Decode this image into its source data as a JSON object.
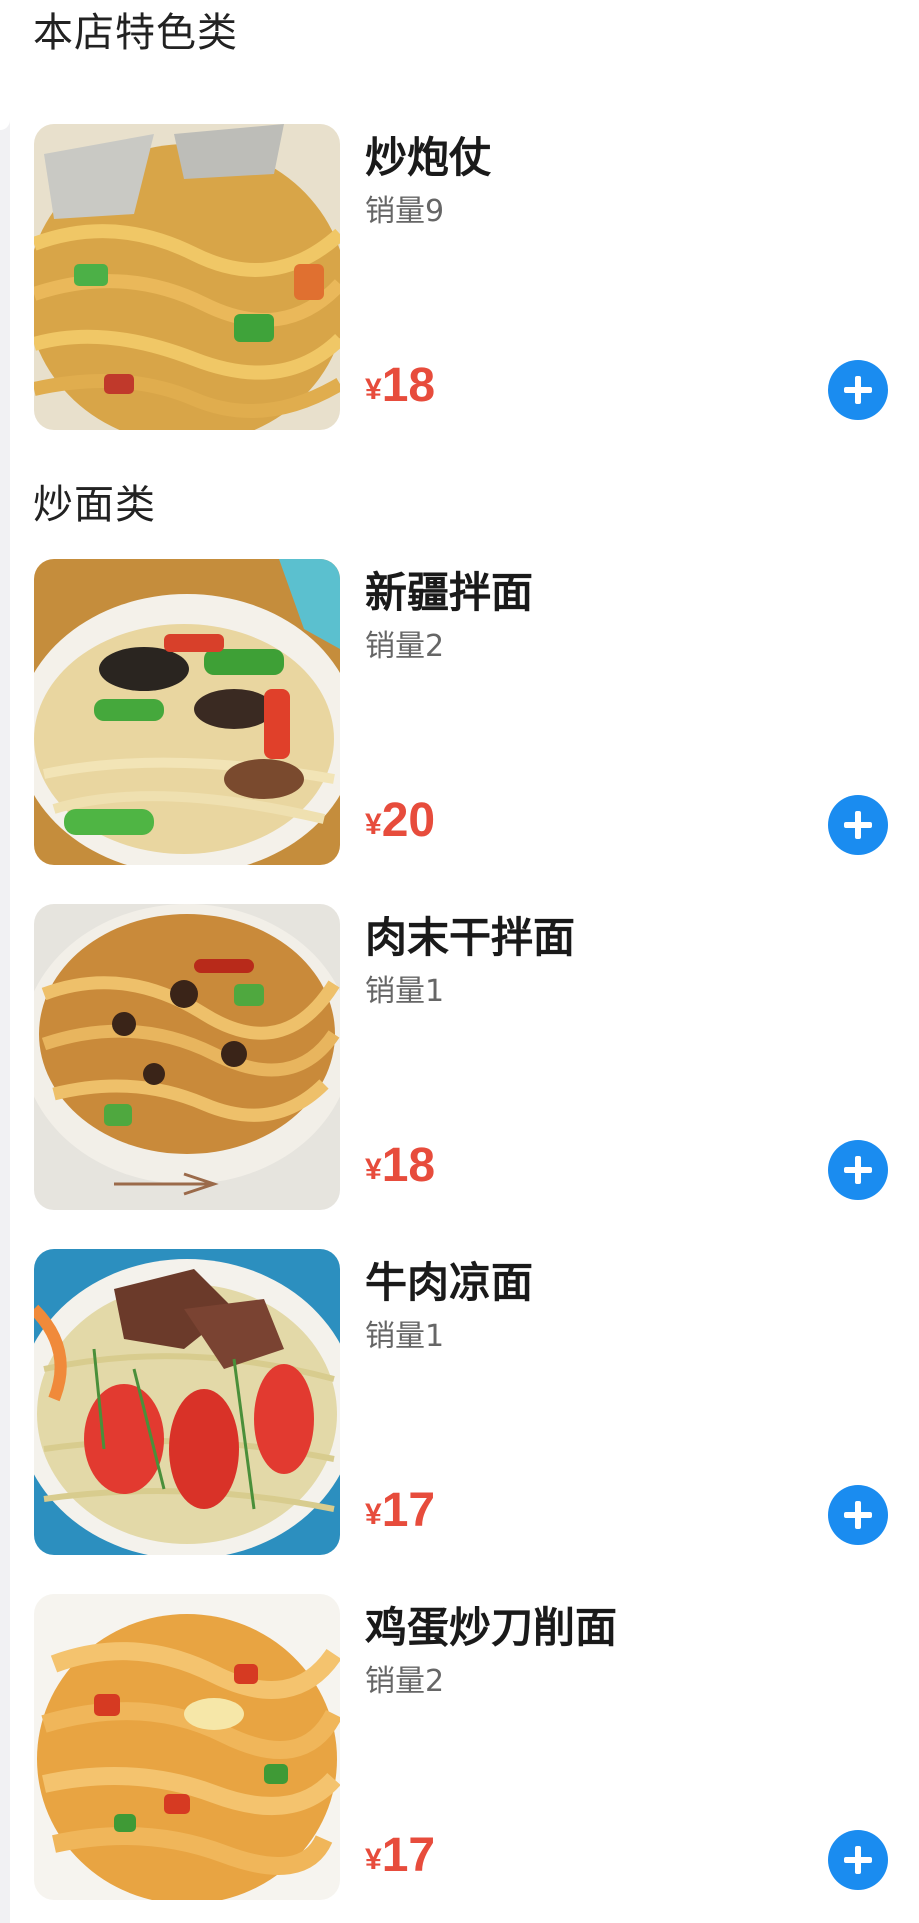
{
  "currency_symbol": "¥",
  "accent_colors": {
    "price": "#e74c3c",
    "add_button": "#1a8cf0"
  },
  "sections": [
    {
      "title": "本店特色类",
      "items": [
        {
          "name": "炒炮仗",
          "sales": "销量9",
          "price": "18",
          "image_icon": "noodle-dish-photo"
        }
      ]
    },
    {
      "title": "炒面类",
      "items": [
        {
          "name": "新疆拌面",
          "sales": "销量2",
          "price": "20",
          "image_icon": "noodle-dish-photo"
        },
        {
          "name": "肉末干拌面",
          "sales": "销量1",
          "price": "18",
          "image_icon": "noodle-dish-photo"
        },
        {
          "name": "牛肉凉面",
          "sales": "销量1",
          "price": "17",
          "image_icon": "noodle-dish-photo"
        },
        {
          "name": "鸡蛋炒刀削面",
          "sales": "销量2",
          "price": "17",
          "image_icon": "noodle-dish-photo"
        }
      ]
    }
  ]
}
